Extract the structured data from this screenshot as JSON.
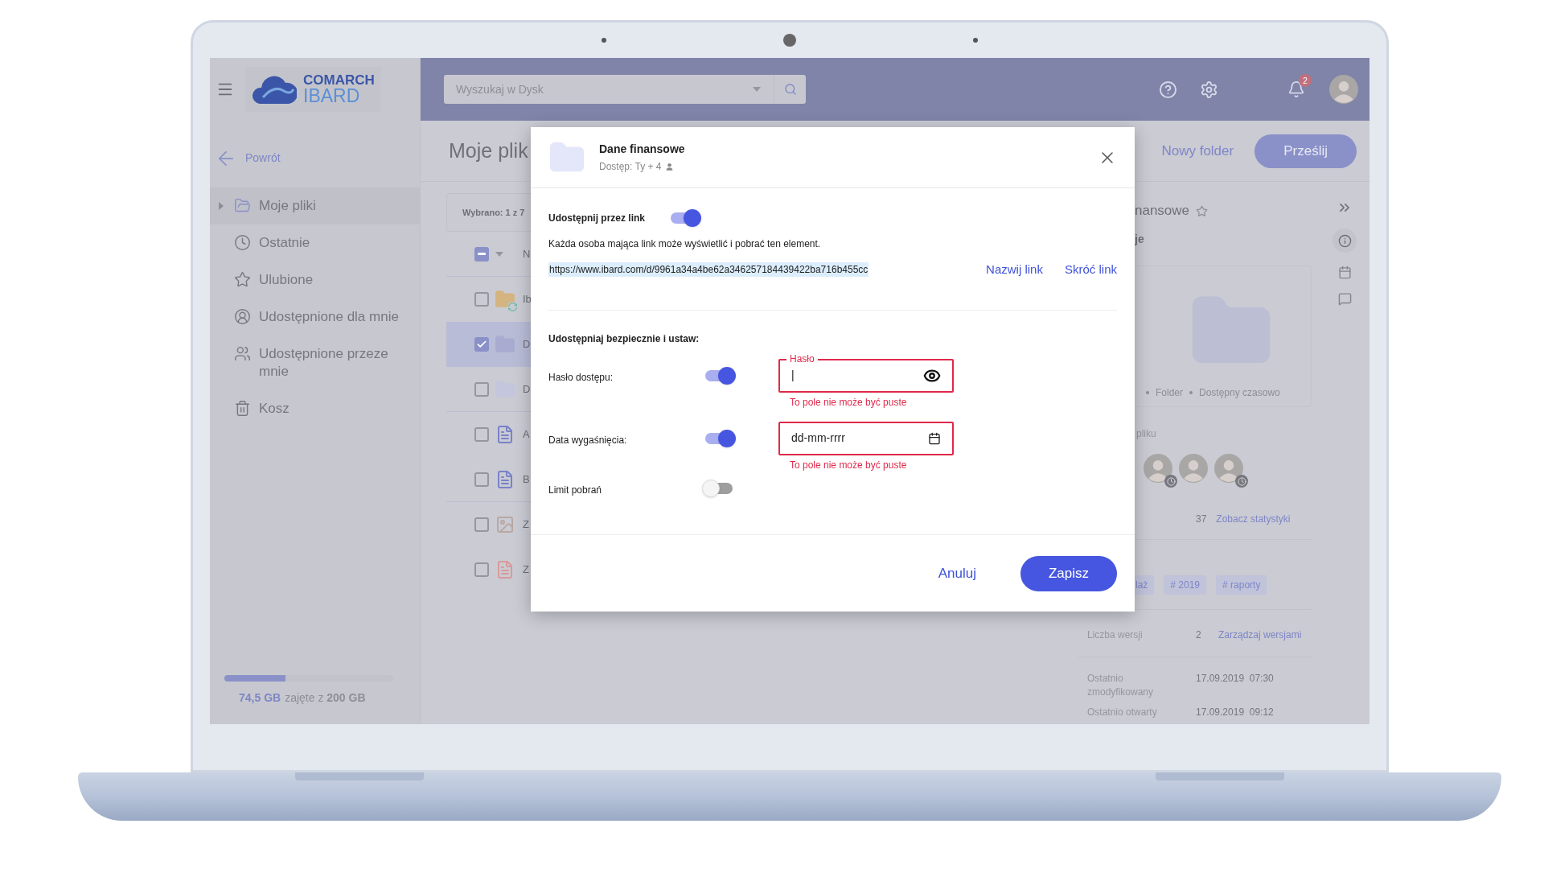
{
  "sidebar": {
    "logo": {
      "line1": "COMARCH",
      "line2": "IBARD"
    },
    "back": "Powrót",
    "items": [
      {
        "label": "Moje pliki",
        "selected": true
      },
      {
        "label": "Ostatnie",
        "selected": false
      },
      {
        "label": "Ulubione",
        "selected": false
      },
      {
        "label": "Udostępnione dla mnie",
        "selected": false
      },
      {
        "label": "Udostępnione przeze mnie",
        "selected": false
      },
      {
        "label": "Kosz",
        "selected": false
      }
    ],
    "storage": {
      "level": 0.36,
      "used": "74,5 GB",
      "rest": "zajęte z **200 GB**"
    }
  },
  "topbar": {
    "search": {
      "placeholder": "Wyszukaj w Dysk"
    },
    "notifications": "2"
  },
  "content": {
    "title": "Moje plik",
    "selection": "Wybrano: 1 z 7",
    "header_indeterminate": true,
    "column_1": "N",
    "rows": [
      {
        "name": "Ib",
        "checked": false,
        "kind": "synced-folder"
      },
      {
        "name": "D",
        "checked": true,
        "kind": "folder"
      },
      {
        "name": "D",
        "checked": false,
        "kind": "light-folder"
      },
      {
        "name": "A",
        "checked": false,
        "kind": "doc"
      },
      {
        "name": "B",
        "checked": false,
        "kind": "doc"
      },
      {
        "name": "Z",
        "checked": false,
        "kind": "image"
      },
      {
        "name": "Z",
        "checked": false,
        "kind": "pdf"
      }
    ]
  },
  "actions": {
    "new_folder": "Nowy folder",
    "upload": "Prześlij"
  },
  "details": {
    "title": "nansowe",
    "section": "je",
    "meta": [
      "Folder",
      "Dostępny czasowo"
    ],
    "people_label": "pliku",
    "people": [
      {
        "temporary": true
      },
      {
        "temporary": false
      },
      {
        "temporary": true
      }
    ],
    "stats": {
      "value": "37",
      "link": "Zobacz statystyki"
    },
    "tags": [
      "laż",
      "# 2019",
      "# raporty"
    ],
    "versions": {
      "label": "Liczba wersji",
      "value": "2",
      "link": "Zarządzaj wersjami"
    },
    "dates": [
      {
        "label": "Ostatnio zmodyfikowany",
        "value": "17.09.2019  07:30"
      },
      {
        "label": "Ostatnio otwarty",
        "value": "17.09.2019  09:12"
      }
    ]
  },
  "dialog": {
    "title": "Dane finansowe",
    "access": "Dostęp: Ty + 4",
    "link_share": {
      "label": "Udostępnij przez link",
      "on": true,
      "description": "Każda osoba mająca link może wyświetlić i pobrać ten element.",
      "url": "https://www.ibard.com/d/9961a34a4be62a346257184439422ba716b455cc",
      "name_link": "Nazwij link",
      "shorten_link": "Skróć link"
    },
    "secure_heading": "Udostępniaj bezpiecznie i ustaw:",
    "options": [
      {
        "label": "Hasło dostępu:",
        "on": true,
        "kind": "password",
        "field_label": "Hasło",
        "value": "|",
        "error": "To pole nie może być puste"
      },
      {
        "label": "Data wygaśnięcia:",
        "on": true,
        "kind": "date",
        "value": "dd-mm-rrrr",
        "error": "To pole nie może być puste"
      },
      {
        "label": "Limit pobrań",
        "on": false,
        "kind": "limit"
      }
    ],
    "cancel": "Anuluj",
    "save": "Zapisz"
  }
}
